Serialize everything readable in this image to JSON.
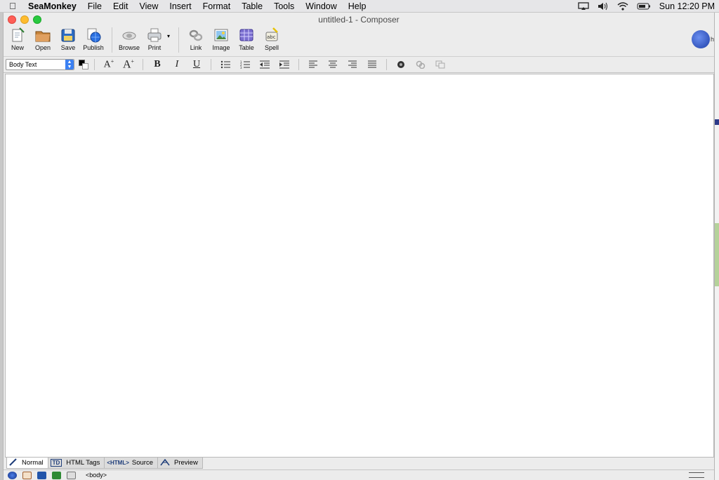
{
  "menubar": {
    "app": "SeaMonkey",
    "items": [
      "File",
      "Edit",
      "View",
      "Insert",
      "Format",
      "Table",
      "Tools",
      "Window",
      "Help"
    ],
    "clock": "Sun 12:20 PM"
  },
  "window": {
    "title": "untitled-1 - Composer"
  },
  "toolbar": {
    "new": "New",
    "open": "Open",
    "save": "Save",
    "publish": "Publish",
    "browse": "Browse",
    "print": "Print",
    "link": "Link",
    "image": "Image",
    "table": "Table",
    "spell": "Spell"
  },
  "format": {
    "paragraph_style": "Body Text",
    "text_color": "#000000",
    "bold": "B",
    "italic": "I",
    "underline": "U"
  },
  "mode_tabs": {
    "normal": "Normal",
    "html_tags": "HTML Tags",
    "html_tags_icon": "TD",
    "source": "Source",
    "source_icon": "<HTML>",
    "preview": "Preview"
  },
  "statusbar": {
    "tag": "<body>"
  }
}
